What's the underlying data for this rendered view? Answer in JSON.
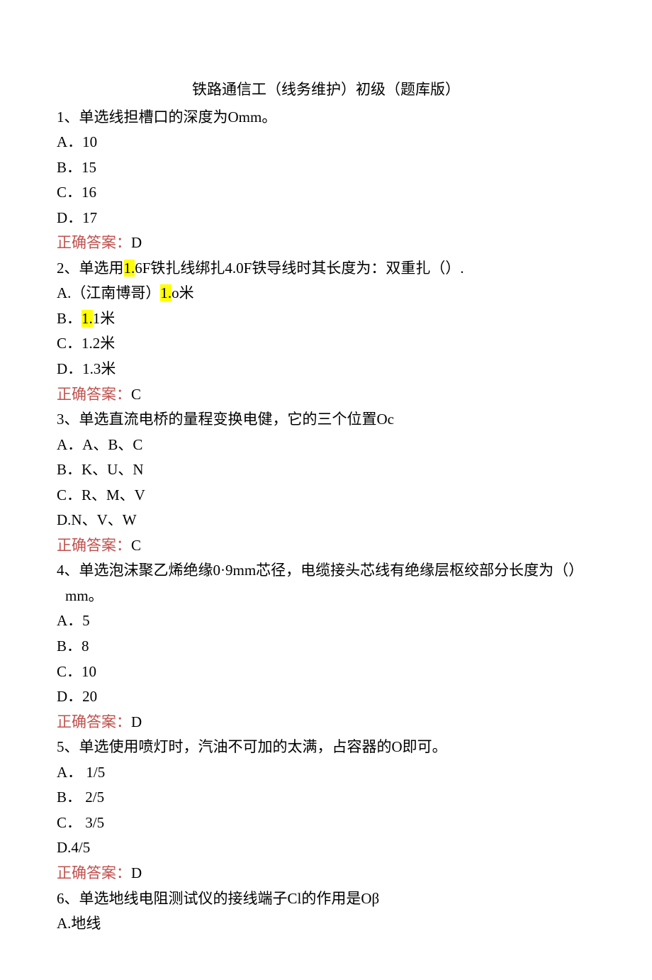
{
  "title": "铁路通信工（线务维护）初级（题库版）",
  "q1": {
    "stem": "1、单选线担槽口的深度为Omm。",
    "a": "A．10",
    "b": "B．15",
    "c": "C．16",
    "d": "D．17",
    "ans_label": "正确答案：",
    "ans_value": "D"
  },
  "q2": {
    "stem_pre": "2、单选用",
    "stem_hl1": "1.",
    "stem_mid": "6F铁扎线绑扎4.0F铁导线时其长度为：双重扎（）.",
    "a_pre": "A.（江南博哥）",
    "a_hl": "1.",
    "a_post": "o米",
    "b_pre": "B．",
    "b_hl": "1.",
    "b_post": "1米",
    "c": "C．1.2米",
    "d": "D．1.3米",
    "ans_label": "正确答案：",
    "ans_value": "C"
  },
  "q3": {
    "stem": "3、单选直流电桥的量程变换电健，它的三个位置Oc",
    "a": "A．A、B、C",
    "b": "B．K、U、N",
    "c": "C．R、M、V",
    "d": "D.N、V、W",
    "ans_label": "正确答案：",
    "ans_value": "C"
  },
  "q4": {
    "stem1": "4、单选泡沫聚乙烯绝缘0·9mm芯径，电缆接头芯线有绝缘层枢绞部分长度为（）",
    "stem2": " mm。",
    "a": "A．5",
    "b": "B．8",
    "c": "C．10",
    "d": "D．20",
    "ans_label": "正确答案：",
    "ans_value": "D"
  },
  "q5": {
    "stem": "5、单选使用喷灯时，汽油不可加的太满，占容器的O即可。",
    "a": "A． 1/5",
    "b": "B． 2/5",
    "c": "C． 3/5",
    "d": "D.4/5",
    "ans_label": "正确答案：",
    "ans_value": "D"
  },
  "q6": {
    "stem": "6、单选地线电阻测试仪的接线端子Cl的作用是Oβ",
    "a": "A.地线"
  }
}
